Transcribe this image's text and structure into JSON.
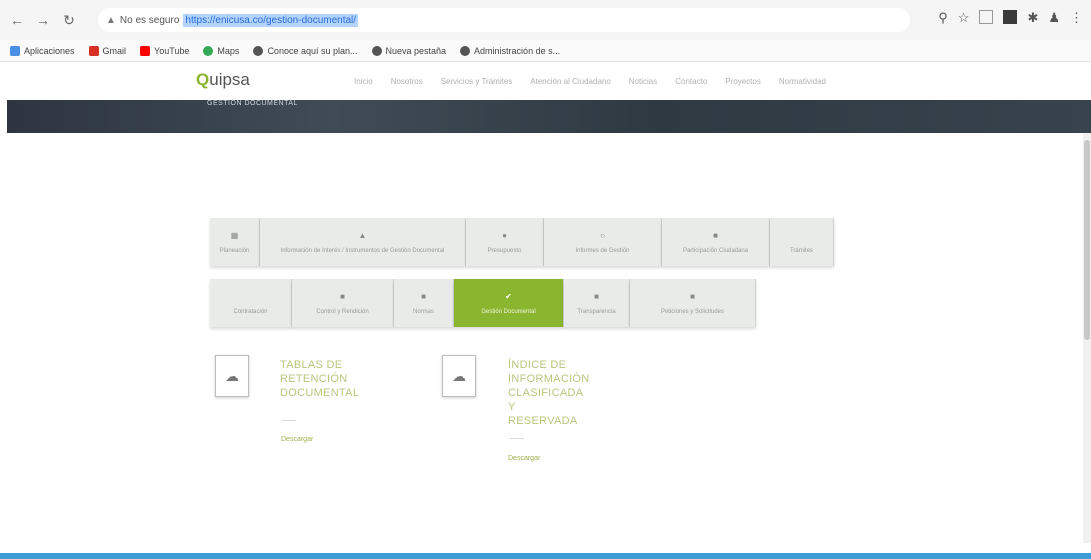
{
  "browser": {
    "security_label": "No es seguro",
    "url": "https://enicusa.co/gestion-documental/",
    "bookmarks": [
      "Aplicaciones",
      "Gmail",
      "YouTube",
      "Maps",
      "Conoce aquí su plan...",
      "Nueva pestaña",
      "Administración de s..."
    ]
  },
  "site": {
    "logo_letter": "Q",
    "logo_text": "uipsa",
    "menu": [
      "Inicio",
      "Nosotros",
      "Servicios y Trámites",
      "Atención al Ciudadano",
      "Noticias",
      "Contacto",
      "Proyectos",
      "Normatividad"
    ],
    "banner_title": "GESTIÓN DOCUMENTAL"
  },
  "tabs_row1": [
    {
      "label": "Planeación",
      "icon": "grid-icon"
    },
    {
      "label": "Información de Interés / Instrumentos de Gestión Documental",
      "icon": "info-icon"
    },
    {
      "label": "Presupuesto",
      "icon": "money-icon"
    },
    {
      "label": "Informes de Gestión",
      "icon": "chart-icon"
    },
    {
      "label": "Participación Ciudadana",
      "icon": "people-icon"
    },
    {
      "label": "Trámites",
      "icon": "doc-icon"
    }
  ],
  "tabs_row2": [
    {
      "label": "Contratación",
      "icon": ""
    },
    {
      "label": "Control y Rendición",
      "icon": "check-icon"
    },
    {
      "label": "Normas",
      "icon": "book-icon"
    },
    {
      "label": "Gestión Documental",
      "icon": "folder-icon",
      "active": true
    },
    {
      "label": "Transparencia",
      "icon": "eye-icon"
    },
    {
      "label": "Peticiones y Solicitudes",
      "icon": "mail-icon"
    }
  ],
  "cards": [
    {
      "title": [
        "TABLAS DE",
        "RETENCIÓN",
        "DOCUMENTAL"
      ],
      "link": "Descargar"
    },
    {
      "title": [
        "ÍNDICE DE",
        "INFORMACIÓN",
        "CLASIFICADA Y",
        "RESERVADA"
      ],
      "link": "Descargar"
    }
  ]
}
